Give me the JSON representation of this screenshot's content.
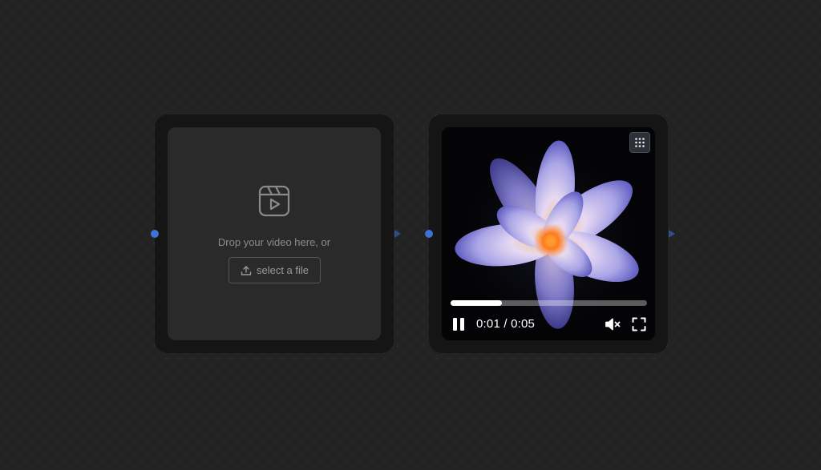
{
  "upload_node": {
    "drop_text": "Drop your video here, or",
    "select_label": "select a file",
    "icon": "video-reel-icon"
  },
  "video_node": {
    "current_time": "0:01",
    "duration": "0:05",
    "progress": 0.26,
    "icons": [
      "grid-dots-icon",
      "pause-icon",
      "mute-icon",
      "fullscreen-icon"
    ]
  },
  "colors": {
    "canvas_bg": "#232323",
    "node_bg": "#151515",
    "port": "#3b74d6"
  }
}
